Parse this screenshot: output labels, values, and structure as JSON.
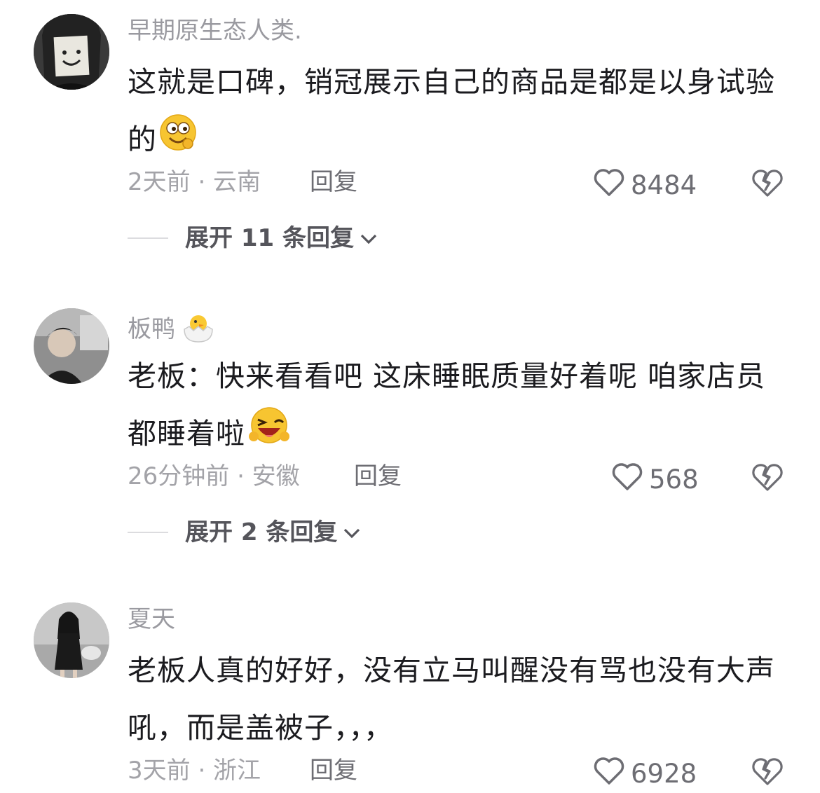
{
  "comments": [
    {
      "username": "早期原生态人类.",
      "body": "这就是口碑，销冠展示自己的商品是都是以身试验的",
      "body_emoji": "smiling-emoji-face",
      "time_location": "2天前 · 云南",
      "reply_label": "回复",
      "likes": "8484",
      "expand_label": "展开 11 条回复"
    },
    {
      "username": "板鸭",
      "username_emoji": "hatching-chick-emoji",
      "body": "老板：快来看看吧 这床睡眠质量好着呢 咱家店员都睡着啦",
      "body_emoji": "winking-laugh-emoji",
      "time_location": "26分钟前 · 安徽",
      "reply_label": "回复",
      "likes": "568",
      "expand_label": "展开 2 条回复"
    },
    {
      "username": "夏天",
      "body": "老板人真的好好，没有立马叫醒没有骂也没有大声吼，而是盖被子，，，",
      "time_location": "3天前 · 浙江",
      "reply_label": "回复",
      "likes": "6928"
    }
  ],
  "colors": {
    "username": "#9a9aa0",
    "body_text": "#1b1b1f",
    "meta_text": "#a3a3a8",
    "icon_stroke": "#6d6d73"
  }
}
